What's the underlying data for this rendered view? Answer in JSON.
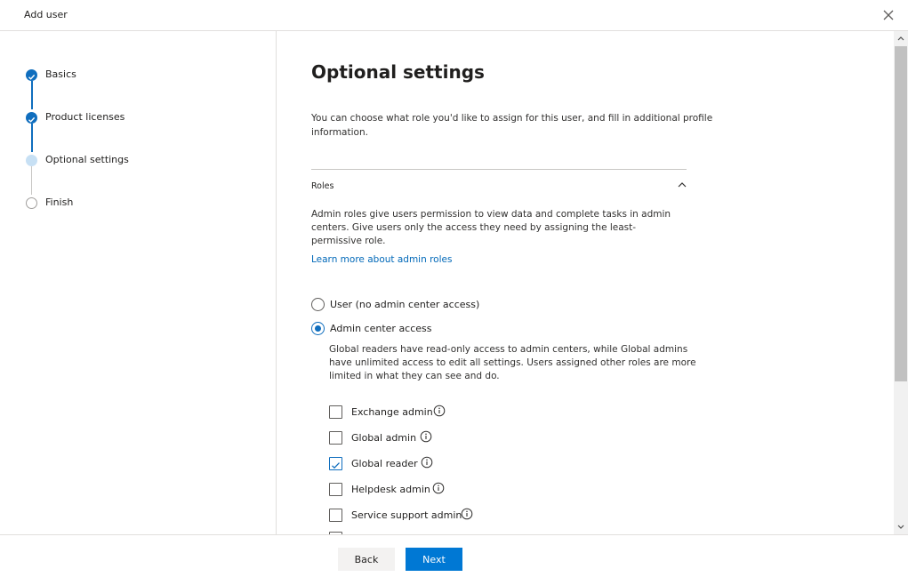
{
  "window": {
    "title": "Add user"
  },
  "steps": [
    {
      "label": "Basics",
      "state": "done"
    },
    {
      "label": "Product licenses",
      "state": "done"
    },
    {
      "label": "Optional settings",
      "state": "current"
    },
    {
      "label": "Finish",
      "state": "todo"
    }
  ],
  "main": {
    "heading": "Optional settings",
    "intro": "You can choose what role you'd like to assign for this user, and fill in additional profile information.",
    "roles_section": {
      "title": "Roles",
      "expanded": true,
      "description": "Admin roles give users permission to view data and complete tasks in admin centers. Give users only the access they need by assigning the least-permissive role.",
      "learn_more": "Learn more about admin roles",
      "options": [
        {
          "label": "User (no admin center access)",
          "selected": false
        },
        {
          "label": "Admin center access",
          "selected": true
        }
      ],
      "admin_description": "Global readers have read-only access to admin centers, while Global admins have unlimited access to edit all settings. Users assigned other roles are more limited in what they can see and do.",
      "roles": [
        {
          "label": "Exchange admin",
          "checked": false
        },
        {
          "label": "Global admin",
          "checked": false
        },
        {
          "label": "Global reader",
          "checked": true
        },
        {
          "label": "Helpdesk admin",
          "checked": false
        },
        {
          "label": "Service support admin",
          "checked": false
        }
      ]
    }
  },
  "footer": {
    "back_label": "Back",
    "next_label": "Next"
  },
  "colors": {
    "accent": "#0078d4",
    "step_done": "#106ebe",
    "step_current": "#c7e0f4"
  }
}
